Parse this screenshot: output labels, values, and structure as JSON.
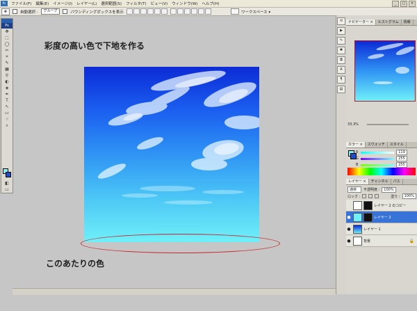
{
  "app": {
    "menu": [
      "ファイル(F)",
      "編集(E)",
      "イメージ(I)",
      "レイヤー(L)",
      "選択範囲(S)",
      "フィルタ(T)",
      "ビュー(V)",
      "ウィンドウ(W)",
      "ヘルプ(H)"
    ],
    "window_controls": [
      "_",
      "□",
      "×"
    ]
  },
  "options_bar": {
    "auto_select_label": "自動選択 :",
    "auto_select_value": "グループ",
    "bounding_box_label": "バウンディングボックスを表示",
    "workspace_label": "ワークスペース ▾"
  },
  "toolbox": {
    "logo": "Ps",
    "tools": [
      "✥",
      "⬚",
      "◯",
      "✂",
      "⌖",
      "✎",
      "▦",
      "⚲",
      "◐",
      "◈",
      "✒",
      "T",
      "↖",
      "▭",
      "☝",
      "⌕"
    ],
    "fg_color": "#7ff2f7",
    "bg_color": "#1e4dc8"
  },
  "annotations": {
    "heading": "彩度の高い色で下地を作る",
    "caption": "このあたりの色",
    "ellipse_color": "#c2272d"
  },
  "navigator": {
    "tabs": [
      "ナビゲーター ×",
      "ヒストグラム",
      "情報"
    ],
    "zoom": "33.3%"
  },
  "color_panel": {
    "tabs": [
      "カラー ×",
      "スウォッチ",
      "スタイル"
    ],
    "channels": [
      {
        "name": "R",
        "value": "119"
      },
      {
        "name": "G",
        "value": "255"
      },
      {
        "name": "B",
        "value": "255"
      }
    ]
  },
  "layers_panel": {
    "tabs": [
      "レイヤー ×",
      "チャンネル",
      "パス"
    ],
    "blend_mode": "通常",
    "opacity_label": "不透明度 :",
    "opacity_value": "100%",
    "lock_label": "ロック :",
    "fill_label": "塗り :",
    "fill_value": "100%",
    "layers": [
      {
        "name": "レイヤー 2 のコピー",
        "selected": false,
        "visible": false
      },
      {
        "name": "レイヤー 2",
        "selected": true,
        "visible": true
      },
      {
        "name": "レイヤー 1",
        "selected": false,
        "visible": true
      },
      {
        "name": "背景",
        "selected": false,
        "visible": true
      }
    ]
  }
}
